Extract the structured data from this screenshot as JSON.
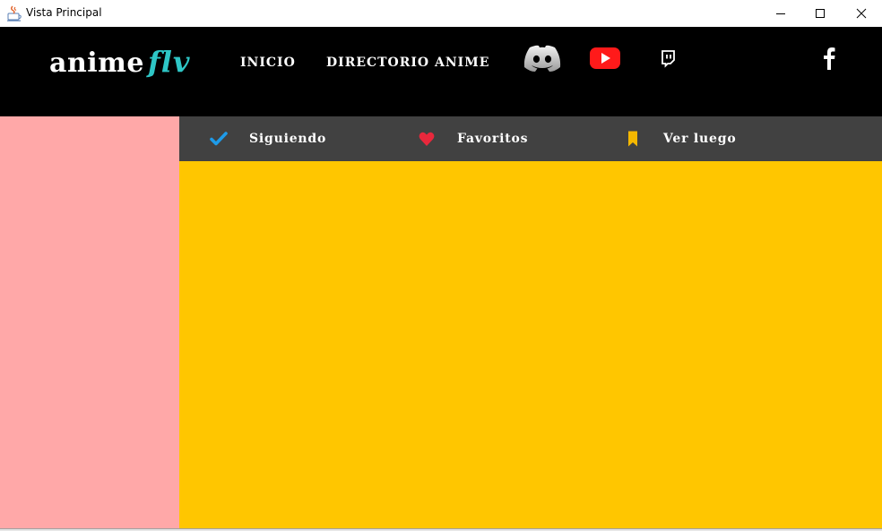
{
  "window": {
    "title": "Vista Principal",
    "icons": {
      "app": "java-app-icon",
      "minimize": "minimize-icon",
      "maximize": "maximize-icon",
      "close": "close-icon"
    }
  },
  "header": {
    "logo": {
      "part1": "anime",
      "part2": "flv"
    },
    "nav": [
      {
        "label": "INICIO"
      },
      {
        "label": "DIRECTORIO ANIME"
      }
    ],
    "social": [
      {
        "icon": "discord-icon"
      },
      {
        "icon": "youtube-icon"
      },
      {
        "icon": "twitch-icon"
      },
      {
        "icon": "facebook-icon"
      }
    ]
  },
  "tabs": [
    {
      "label": "Siguiendo",
      "icon": "checkmark-icon",
      "icon_color": "#1e9be9"
    },
    {
      "label": "Favoritos",
      "icon": "heart-icon",
      "icon_color": "#e8283c"
    },
    {
      "label": "Ver luego",
      "icon": "bookmark-icon",
      "icon_color": "#f5b800"
    }
  ],
  "colors": {
    "header_bg": "#000000",
    "logo_accent": "#2ec6c6",
    "side_panel": "#ffa8a8",
    "tabbar_bg": "#414141",
    "main_area": "#ffc600",
    "youtube_red": "#ff0000"
  }
}
